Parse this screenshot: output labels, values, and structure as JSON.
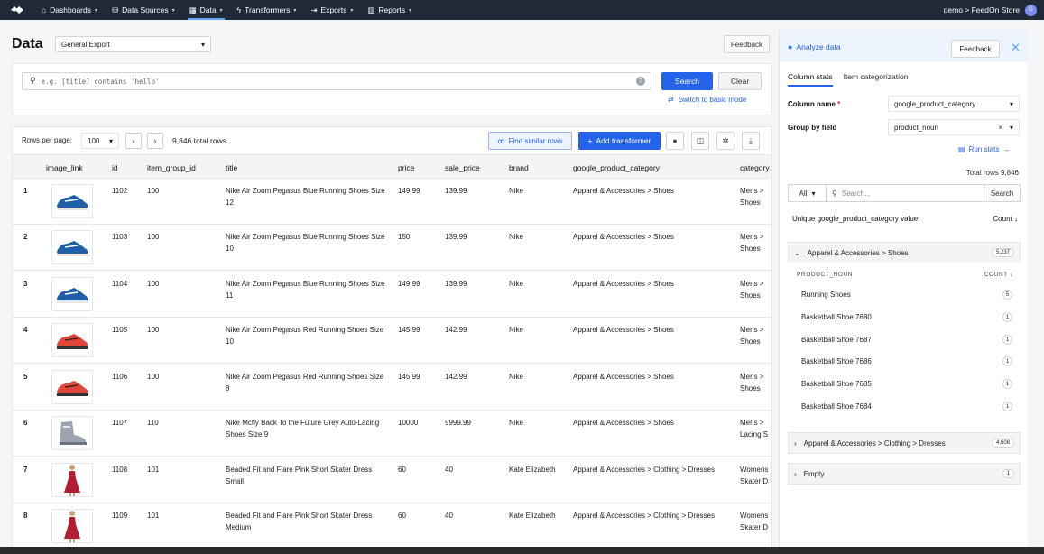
{
  "nav": {
    "items": [
      {
        "label": "Dashboards",
        "icon": "home-icon"
      },
      {
        "label": "Data Sources",
        "icon": "database-icon"
      },
      {
        "label": "Data",
        "icon": "table-icon",
        "active": true
      },
      {
        "label": "Transformers",
        "icon": "bolt-icon"
      },
      {
        "label": "Exports",
        "icon": "export-icon"
      },
      {
        "label": "Reports",
        "icon": "chart-icon"
      }
    ],
    "account": "demo > FeedOn Store",
    "avatar_initials": "G"
  },
  "header": {
    "title": "Data",
    "export_select": "General Export",
    "feedback": "Feedback"
  },
  "search": {
    "placeholder": "e.g. [title] contains 'hello'",
    "search_label": "Search",
    "clear_label": "Clear",
    "switch_label": "Switch to basic mode"
  },
  "toolbar": {
    "rows_per_page_label": "Rows per page:",
    "rows_per_page": "100",
    "total_rows": "9,846 total rows",
    "find_similar": "Find similar rows",
    "add_transformer": "Add transformer"
  },
  "table": {
    "columns": [
      "image_link",
      "id",
      "item_group_id",
      "title",
      "price",
      "sale_price",
      "brand",
      "google_product_category",
      "category"
    ],
    "rows": [
      {
        "n": "1",
        "id": "1102",
        "group": "100",
        "title": "Nike Air Zoom Pegasus Blue Running Shoes Size 12",
        "price": "149.99",
        "sale": "139.99",
        "brand": "Nike",
        "gpc": "Apparel & Accessories > Shoes",
        "cat": "Mens > Shoes",
        "img": "blue-shoe"
      },
      {
        "n": "2",
        "id": "1103",
        "group": "100",
        "title": "Nike Air Zoom Pegasus Blue Running Shoes Size 10",
        "price": "150",
        "sale": "139.99",
        "brand": "Nike",
        "gpc": "Apparel & Accessories > Shoes",
        "cat": "Mens > Shoes",
        "img": "blue-shoe"
      },
      {
        "n": "3",
        "id": "1104",
        "group": "100",
        "title": "Nike Air Zoom Pegasus Blue Running Shoes Size 11",
        "price": "149.99",
        "sale": "139.99",
        "brand": "Nike",
        "gpc": "Apparel & Accessories > Shoes",
        "cat": "Mens > Shoes",
        "img": "blue-shoe"
      },
      {
        "n": "4",
        "id": "1105",
        "group": "100",
        "title": "Nike Air Zoom Pegasus Red Running Shoes Size 10",
        "price": "145.99",
        "sale": "142.99",
        "brand": "Nike",
        "gpc": "Apparel & Accessories > Shoes",
        "cat": "Mens > Shoes",
        "img": "red-shoe"
      },
      {
        "n": "5",
        "id": "1106",
        "group": "100",
        "title": "Nike Air Zoom Pegasus Red Running Shoes Size 8",
        "price": "145.99",
        "sale": "142.99",
        "brand": "Nike",
        "gpc": "Apparel & Accessories > Shoes",
        "cat": "Mens > Shoes",
        "img": "red-shoe"
      },
      {
        "n": "6",
        "id": "1107",
        "group": "110",
        "title": "Nike Mcfly Back To the Future Grey Auto-Lacing Shoes Size 9",
        "price": "10000",
        "sale": "9999.99",
        "brand": "Nike",
        "gpc": "Apparel & Accessories > Shoes",
        "cat": "Mens > Lacing S",
        "img": "grey-shoe"
      },
      {
        "n": "7",
        "id": "1108",
        "group": "101",
        "title": "Beaded Fit and Flare Pink Short Skater Dress Small",
        "price": "60",
        "sale": "40",
        "brand": "Kate Elizabeth",
        "gpc": "Apparel & Accessories > Clothing > Dresses",
        "cat": "Womens Skater D",
        "img": "dress"
      },
      {
        "n": "8",
        "id": "1109",
        "group": "101",
        "title": "Beaded Fit and Flare Pink Short Skater Dress Medium",
        "price": "60",
        "sale": "40",
        "brand": "Kate Elizabeth",
        "gpc": "Apparel & Accessories > Clothing > Dresses",
        "cat": "Womens Skater D",
        "img": "dress"
      }
    ]
  },
  "analyze": {
    "title": "Analyze data",
    "feedback": "Feedback",
    "tabs": [
      "Column stats",
      "Item categorization"
    ],
    "column_name_label": "Column name",
    "column_name_value": "google_product_category",
    "group_by_label": "Group by field",
    "group_by_value": "product_noun",
    "run_stats": "Run stats",
    "total_rows": "Total rows 9,846",
    "filter_all": "All",
    "filter_placeholder": "Search...",
    "filter_search": "Search",
    "unique_header": "Unique google_product_category value",
    "count_header": "Count",
    "groups": [
      {
        "label": "Apparel & Accessories > Shoes",
        "count": "5,237",
        "expanded": true
      },
      {
        "label": "Apparel & Accessories > Clothing > Dresses",
        "count": "4,608"
      },
      {
        "label": "Empty",
        "count": "1"
      }
    ],
    "sub_header": {
      "left": "PRODUCT_NOUN",
      "right": "COUNT"
    },
    "sub_items": [
      {
        "label": "Running Shoes",
        "count": "5"
      },
      {
        "label": "Basketball Shoe 7680",
        "count": "1"
      },
      {
        "label": "Basketball Shoe 7687",
        "count": "1"
      },
      {
        "label": "Basketball Shoe 7686",
        "count": "1"
      },
      {
        "label": "Basketball Shoe 7685",
        "count": "1"
      },
      {
        "label": "Basketball Shoe 7684",
        "count": "1"
      }
    ]
  }
}
